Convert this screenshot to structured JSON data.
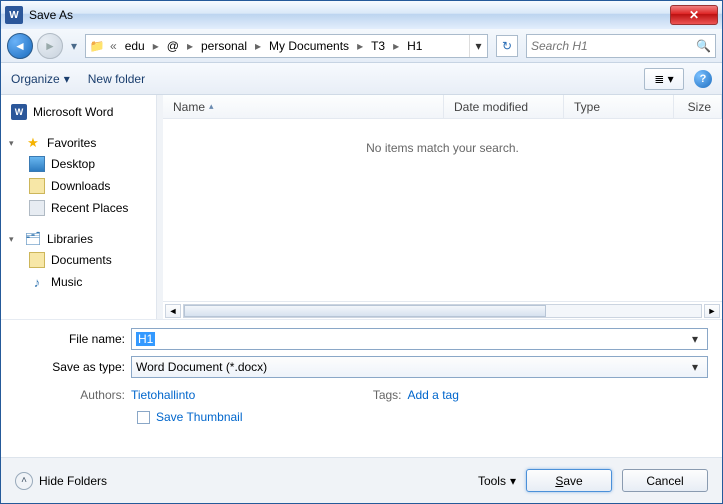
{
  "title": "Save As",
  "breadcrumb": {
    "prefix": "«",
    "items": [
      "edu",
      "@",
      "personal",
      "My Documents",
      "T3",
      "H1"
    ]
  },
  "search": {
    "placeholder": "Search H1"
  },
  "toolbar": {
    "organize": "Organize",
    "newfolder": "New folder"
  },
  "columns": {
    "name": "Name",
    "date": "Date modified",
    "type": "Type",
    "size": "Size"
  },
  "empty_msg": "No items match your search.",
  "sidebar": {
    "top": "Microsoft Word",
    "favorites": "Favorites",
    "fav_items": [
      "Desktop",
      "Downloads",
      "Recent Places"
    ],
    "libraries": "Libraries",
    "lib_items": [
      "Documents",
      "Music"
    ]
  },
  "form": {
    "filename_label": "File name:",
    "filename_value": "H1",
    "type_label": "Save as type:",
    "type_value": "Word Document (*.docx)",
    "authors_label": "Authors:",
    "authors_value": "Tietohallinto",
    "tags_label": "Tags:",
    "tags_value": "Add a tag",
    "thumb_label": "Save Thumbnail"
  },
  "footer": {
    "hide": "Hide Folders",
    "tools": "Tools",
    "save": "Save",
    "cancel": "Cancel"
  }
}
